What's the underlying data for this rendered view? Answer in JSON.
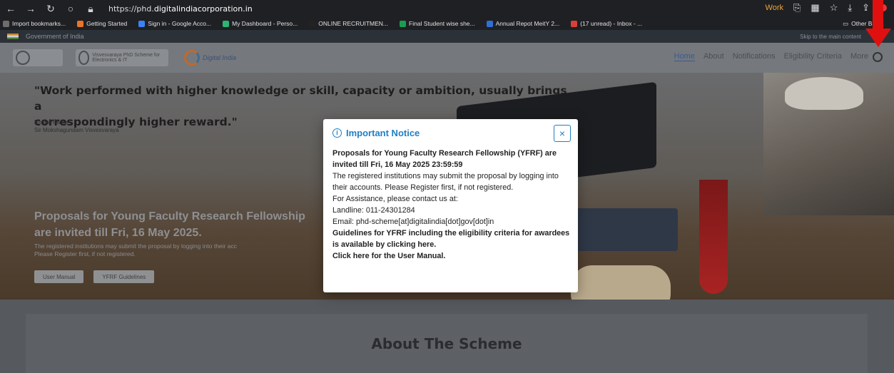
{
  "browser": {
    "url_prefix": "https://phd.",
    "url_domain": "digitalindiacorporation.in",
    "work_label": "Work",
    "bookmarks": [
      {
        "label": "Import bookmarks...",
        "color": "#6d6d6d"
      },
      {
        "label": "Getting Started",
        "color": "#e8742a"
      },
      {
        "label": "Sign in - Google Acco...",
        "color": "#3b82f6"
      },
      {
        "label": "My Dashboard - Perso...",
        "color": "#2bb673"
      },
      {
        "label": "ONLINE RECRUITMEN...",
        "color": "#222222"
      },
      {
        "label": "Final Student wise she...",
        "color": "#1b9c52"
      },
      {
        "label": "Annual Repot MeitY 2...",
        "color": "#2f6fd6"
      },
      {
        "label": "(17 unread) - Inbox - ...",
        "color": "#d8413a"
      }
    ],
    "other_bookmarks": "Other Boo..."
  },
  "gov_strip": {
    "label": "Government of India",
    "skip": "Skip to the main content"
  },
  "header": {
    "logo2_text": "Visvesvaraya PhD Scheme for Electronics & IT",
    "logo3_text": "Digital India",
    "menu": [
      "Home",
      "About",
      "Notifications",
      "Eligibility Criteria",
      "More"
    ]
  },
  "hero": {
    "quote_line1": "\"Work performed with higher knowledge or skill, capacity or ambition, usually brings a",
    "quote_line2": "correspondingly higher reward.\"",
    "author_title": "Bharat Ratna",
    "author_name": "Sir Mokshagundam Visvesvaraya",
    "title_line1": "Proposals for Young Faculty Research Fellowship",
    "title_line2": "are invited till Fri, 16 May 2025.",
    "sub_line1": "The registered institutions may submit the proposal by logging into their acc",
    "sub_line2": "Please Register first, if not registered.",
    "btn_manual": "User Manual",
    "btn_guidelines": "YFRF Guidelines"
  },
  "about": {
    "title": "About The Scheme"
  },
  "modal": {
    "title": "Important Notice",
    "close": "×",
    "line_bold_1": "Proposals for Young Faculty Research Fellowship (YFRF) are invited till Fri, 16 May 2025 23:59:59",
    "line_2": "The registered institutions may submit the proposal by logging into their accounts. Please Register first, if not registered.",
    "line_3": "For Assistance, please contact us at:",
    "line_4": "Landline: 011-24301284",
    "line_5": "Email: phd-scheme[at]digitalindia[dot]gov[dot]in",
    "line_bold_6": "Guidelines for YFRF including the eligibility criteria for awardees is available by clicking here.",
    "line_bold_7": "Click here for the User Manual."
  },
  "colors": {
    "accent": "#1f7fc4",
    "annotation_arrow": "#e01010"
  }
}
